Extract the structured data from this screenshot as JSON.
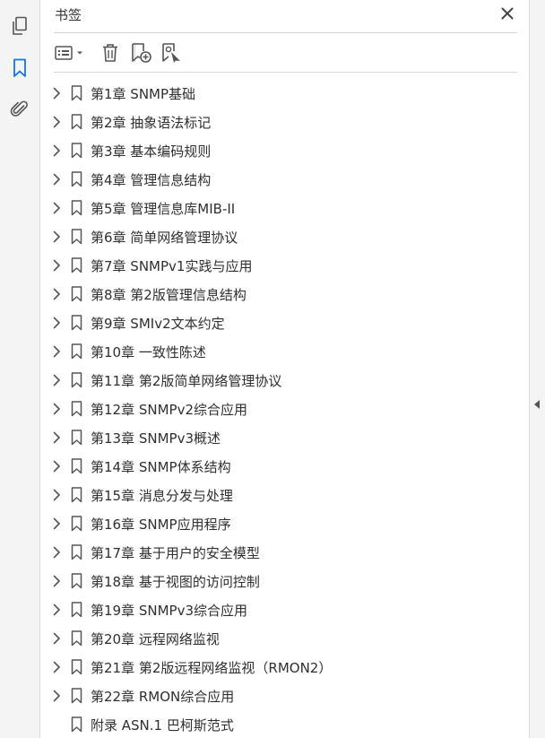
{
  "panel": {
    "title": "书签",
    "close_icon": "close-icon"
  },
  "rail": {
    "icons": [
      "pages-icon",
      "bookmark-icon",
      "attachment-icon"
    ],
    "active": "bookmark-icon",
    "accent": "#1473e6"
  },
  "toolbar": {
    "icons": [
      "options-menu-icon",
      "delete-icon",
      "new-bookmark-icon",
      "new-bookmark-from-structure-icon"
    ]
  },
  "bookmarks": [
    {
      "label": "第1章 SNMP基础",
      "expandable": true
    },
    {
      "label": "第2章 抽象语法标记",
      "expandable": true
    },
    {
      "label": "第3章 基本编码规则",
      "expandable": true
    },
    {
      "label": "第4章 管理信息结构",
      "expandable": true
    },
    {
      "label": "第5章 管理信息库MIB-II",
      "expandable": true
    },
    {
      "label": "第6章 简单网络管理协议",
      "expandable": true
    },
    {
      "label": "第7章 SNMPv1实践与应用",
      "expandable": true
    },
    {
      "label": "第8章 第2版管理信息结构",
      "expandable": true
    },
    {
      "label": "第9章 SMIv2文本约定",
      "expandable": true
    },
    {
      "label": "第10章 一致性陈述",
      "expandable": true
    },
    {
      "label": "第11章 第2版简单网络管理协议",
      "expandable": true
    },
    {
      "label": "第12章 SNMPv2综合应用",
      "expandable": true
    },
    {
      "label": "第13章 SNMPv3概述",
      "expandable": true
    },
    {
      "label": "第14章 SNMP体系结构",
      "expandable": true
    },
    {
      "label": "第15章 消息分发与处理",
      "expandable": true
    },
    {
      "label": "第16章 SNMP应用程序",
      "expandable": true
    },
    {
      "label": "第17章 基于用户的安全模型",
      "expandable": true
    },
    {
      "label": "第18章 基于视图的访问控制",
      "expandable": true
    },
    {
      "label": "第19章 SNMPv3综合应用",
      "expandable": true
    },
    {
      "label": "第20章 远程网络监视",
      "expandable": true
    },
    {
      "label": "第21章 第2版远程网络监视（RMON2）",
      "expandable": true
    },
    {
      "label": "第22章 RMON综合应用",
      "expandable": true
    },
    {
      "label": "附录 ASN.1 巴柯斯范式",
      "expandable": false
    }
  ]
}
